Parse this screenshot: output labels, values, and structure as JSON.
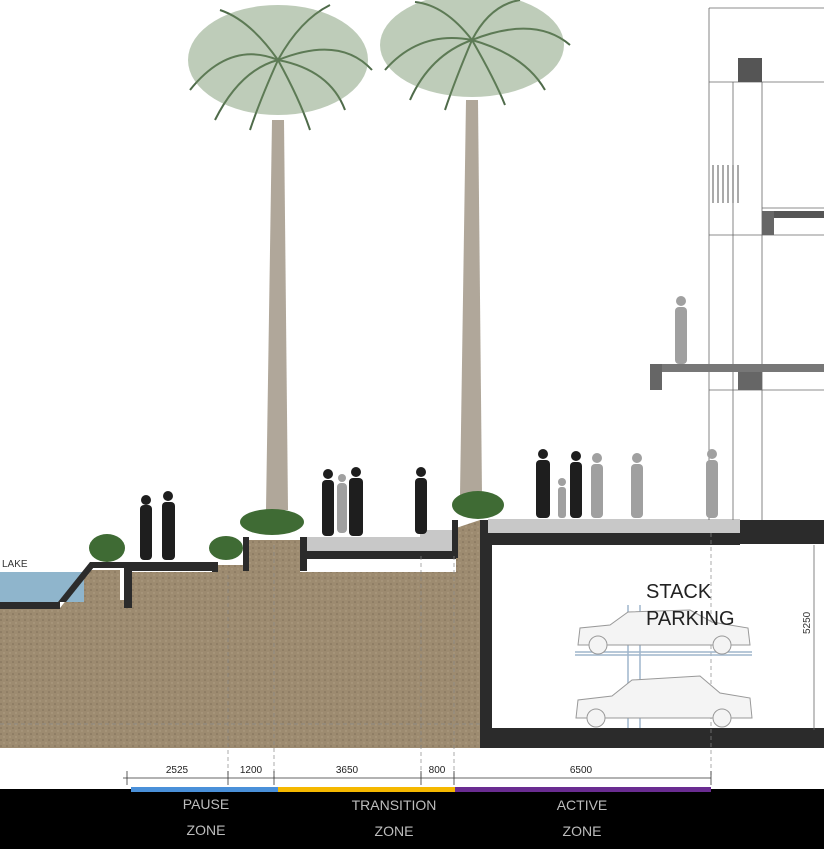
{
  "labels": {
    "lake": "LAKE",
    "stack_parking_line1": "STACK",
    "stack_parking_line2": "PARKING",
    "height_dimension": "5250"
  },
  "dimensions": [
    "2525",
    "1200",
    "3650",
    "800",
    "6500"
  ],
  "zones": [
    {
      "line1": "PAUSE",
      "line2": "ZONE",
      "color": "#4a90d9"
    },
    {
      "line1": "TRANSITION",
      "line2": "ZONE",
      "color": "#f5b800"
    },
    {
      "line1": "ACTIVE",
      "line2": "ZONE",
      "color": "#6a2c91"
    }
  ],
  "colors": {
    "soil": "#9b8a70",
    "water": "#8fb5cc",
    "structure": "#2b2b2b",
    "zone_bar_bg": "#000000"
  }
}
